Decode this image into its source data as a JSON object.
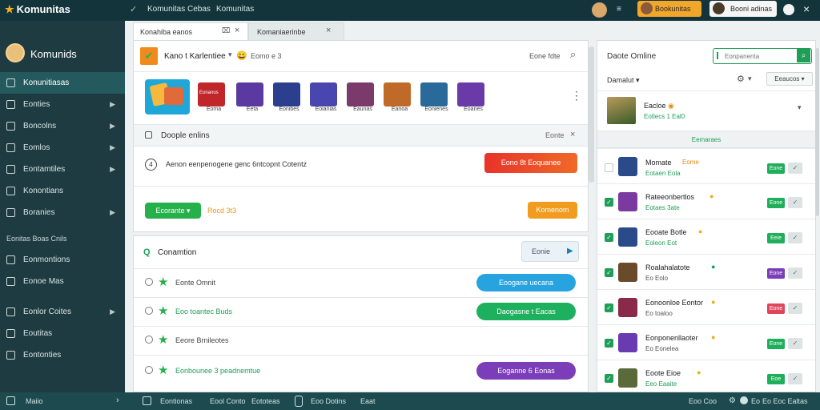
{
  "app": {
    "logo": "Komunitas",
    "top_check": "✓",
    "top_tabs": [
      "Komunitas Cebas",
      "Komunitas"
    ],
    "top_menu_icon": "≡",
    "top_right_text": "Komunitas",
    "top_right_btn": "Bookunitas",
    "top_right_user": "Booni adinas"
  },
  "sidebar": {
    "brand": "Komunids",
    "items": [
      {
        "label": "Konunitiasas",
        "chev": false,
        "active": true
      },
      {
        "label": "Eonties",
        "chev": true
      },
      {
        "label": "Boncolns",
        "chev": true
      },
      {
        "label": "Eomlos",
        "chev": true
      },
      {
        "label": "Eontamtiles",
        "chev": true
      },
      {
        "label": "Konontians",
        "chev": false
      },
      {
        "label": "Boranies",
        "chev": true
      }
    ],
    "section_label": "Eonitas Boas Cnils",
    "items2": [
      {
        "label": "Eonmontions",
        "chev": false
      },
      {
        "label": "Eonoe Mas",
        "chev": false
      }
    ],
    "items3": [
      {
        "label": "Eonlor Coites",
        "chev": true
      },
      {
        "label": "Eoutitas",
        "chev": false
      },
      {
        "label": "Eontonties",
        "chev": false
      }
    ]
  },
  "tabs": [
    {
      "label": "Konahiba eanos",
      "close": "×"
    },
    {
      "label": "Komaniaerinbe",
      "close": "×"
    }
  ],
  "main": {
    "title": "Kano t Karlentiee",
    "emoji": "😀",
    "subtitle": "Eomo e 3",
    "search_label": "Eone fdte",
    "tiles": [
      {
        "label": "",
        "color": "#1fa7d8"
      },
      {
        "label": "Eoma",
        "color": "#c0262a"
      },
      {
        "label": "Eeta",
        "color": "#5a3aa0"
      },
      {
        "label": "Eonibes",
        "color": "#2c3f8e"
      },
      {
        "label": "Eoianias",
        "color": "#4a46b0"
      },
      {
        "label": "Eaunas",
        "color": "#7a3a6a"
      },
      {
        "label": "Eanoa",
        "color": "#c06a2a"
      },
      {
        "label": "Eonienes",
        "color": "#2a6a9a"
      },
      {
        "label": "Eoanes",
        "color": "#6a3aa8"
      }
    ],
    "tile_banner": "Eonanos",
    "more_icon": "⋮",
    "online_title": "Doople enlins",
    "online_tag": "Eonte",
    "close_x": "×",
    "invite_num": "4",
    "invite_text": "Aenon eenpenogene genc 6ntcopnt Cotentz",
    "invite_btn": "Eono 8t Eoquanee",
    "status_btn": "Ecorante",
    "status_chev": "▾",
    "status_text": "Rocd 3t3",
    "right_orange_btn": "Komenom"
  },
  "lower": {
    "title": "Conamtion",
    "sort_label": "Eonie",
    "rows": [
      {
        "text": "Eonte Omnit",
        "btn": "Eoogane uecana",
        "color": "#27a4e0"
      },
      {
        "text": "Eoo toantec Buds",
        "btn": "Daogasne t Eacas",
        "color": "#1db05e"
      },
      {
        "text": "Eeore Brnileotes",
        "btn": "",
        "color": ""
      },
      {
        "text": "Eonbounee 3 peadnemtue",
        "btn": "Eoganne 6 Eonas",
        "color": "#7b3db8"
      }
    ]
  },
  "right": {
    "title": "Daote Omline",
    "search_placeholder": "Eonpanenta",
    "filter_label": "Damalut",
    "filter_chev": "▾",
    "dropdown": "Eeaucos",
    "profile_name": "Eacloe",
    "profile_sub": "Eotlecs 1 Eal0",
    "profile_chev": "▾",
    "section": "Eemaraes",
    "friends": [
      {
        "name": "Momate",
        "badge": "Eome",
        "sub": "Eotaen Eola",
        "tag": "Eone",
        "tagColor": "#1fae5a",
        "checked": false,
        "av": "#2a4a8a"
      },
      {
        "name": "Rateeonbertlos",
        "badge": "",
        "sub": "Eotaes 3ate",
        "tag": "Eone",
        "tagColor": "#1fae5a",
        "checked": true,
        "av": "#7a3aa0"
      },
      {
        "name": "Eooate Botle",
        "badge": "",
        "sub": "Eoleon Eot",
        "tag": "Eeie",
        "tagColor": "#1fae5a",
        "checked": true,
        "av": "#2a4a8a"
      },
      {
        "name": "Roalahalatote",
        "badge": "",
        "sub": "Eo Eolo",
        "tag": "Eone",
        "tagColor": "#7b3db8",
        "checked": true,
        "av": "#6a4a2a"
      },
      {
        "name": "Eonoonloe Eontor",
        "badge": "",
        "sub": "Eo toaloo",
        "tag": "Eone",
        "tagColor": "#e0455a",
        "checked": true,
        "av": "#8a2a4a"
      },
      {
        "name": "Eonponenllaoter",
        "badge": "",
        "sub": "Eo Eonelea",
        "tag": "Eone",
        "tagColor": "#1fae5a",
        "checked": true,
        "av": "#6a3ab0"
      },
      {
        "name": "Eoote Eioe",
        "badge": "",
        "sub": "Eeo Eaaite",
        "tag": "Eoe",
        "tagColor": "#1fae5a",
        "checked": true,
        "av": "#5a6a3a"
      }
    ]
  },
  "footer": {
    "left": "Maiio",
    "chev": "›",
    "items": [
      "Eontionas",
      "Eool Conto",
      "Eototeas",
      "Eoo Dotins",
      "Eaat"
    ],
    "right": [
      "Eoo Coo",
      "Eo",
      "Eo Eoc Ealtas"
    ]
  }
}
